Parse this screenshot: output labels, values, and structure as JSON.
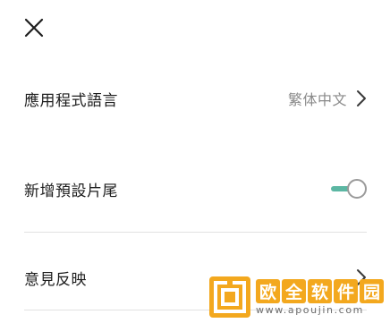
{
  "header": {
    "close_icon": "close-icon"
  },
  "settings": {
    "language": {
      "label": "應用程式語言",
      "value": "繁体中文",
      "icon": "chevron-right-icon"
    },
    "default_ending": {
      "label": "新增預設片尾",
      "enabled": true,
      "accent_color": "#5cb7a3"
    },
    "feedback": {
      "label": "意見反映",
      "icon": "chevron-right-icon"
    }
  },
  "watermark": {
    "chars": [
      "欧",
      "全",
      "软",
      "件",
      "园"
    ],
    "url": "www.apoujin.com",
    "color": "#f3a81e"
  }
}
